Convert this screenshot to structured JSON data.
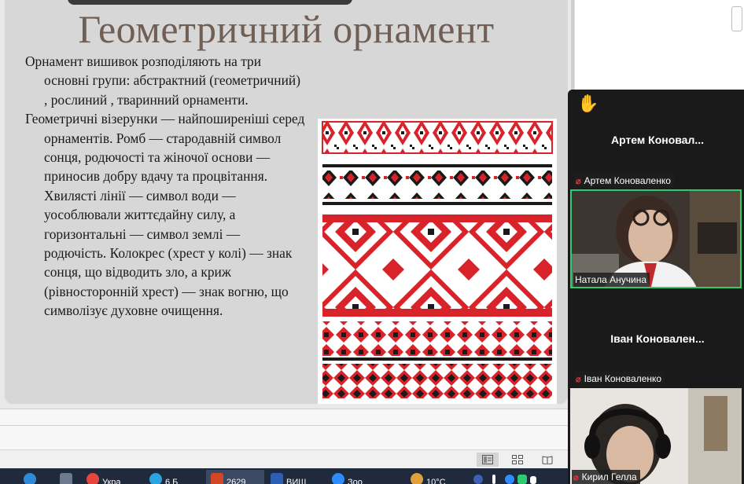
{
  "slide": {
    "title": "Геометричний орнамент",
    "paragraphs": [
      "Орнамент вишивок розподіляють на три основні групи: абстрактний (геометричний) , рослиний , тваринний орнаменти.",
      "Геометричні візерунки — найпоширеніші серед орнаментів. Ромб — стародавній символ сонця, родючості та жіночої основи — приносив добру вдачу та процвітання. Хвилясті лінії — символ води — уособлювали життєдайну силу, а горизонтальні — символ землі — родючість. Колокрес (хрест у колі) — знак сонця, що відводить зло, а криж (рівносторонній хрест) — знак вогню, що символізує духовне очищення."
    ]
  },
  "participants": [
    {
      "tile_name": "Артем  Коновал...",
      "label": "Артем Коноваленко",
      "muted": true,
      "video": false,
      "hand_raised": true
    },
    {
      "tile_name": "",
      "label": "Натала Анучина",
      "muted": false,
      "video": true,
      "active_speaker": true
    },
    {
      "tile_name": "Іван  Коновален...",
      "label": "Іван Коноваленко",
      "muted": true,
      "video": false
    },
    {
      "tile_name": "",
      "label": "Кирил Гелла",
      "muted": true,
      "video": true
    }
  ],
  "taskbar": {
    "items": [
      "Укра",
      "6 Б",
      "2629",
      "ВИШ",
      "Зоо"
    ],
    "weather": "10°C"
  },
  "icons": {
    "hand": "raised-hand-icon",
    "mute": "muted-mic-icon",
    "views": [
      "normal-view-icon",
      "slide-sorter-icon",
      "reading-view-icon"
    ]
  },
  "colors": {
    "title": "#6f5f55",
    "ornament_red": "#d8232a",
    "active_speaker": "#2ecc71"
  }
}
